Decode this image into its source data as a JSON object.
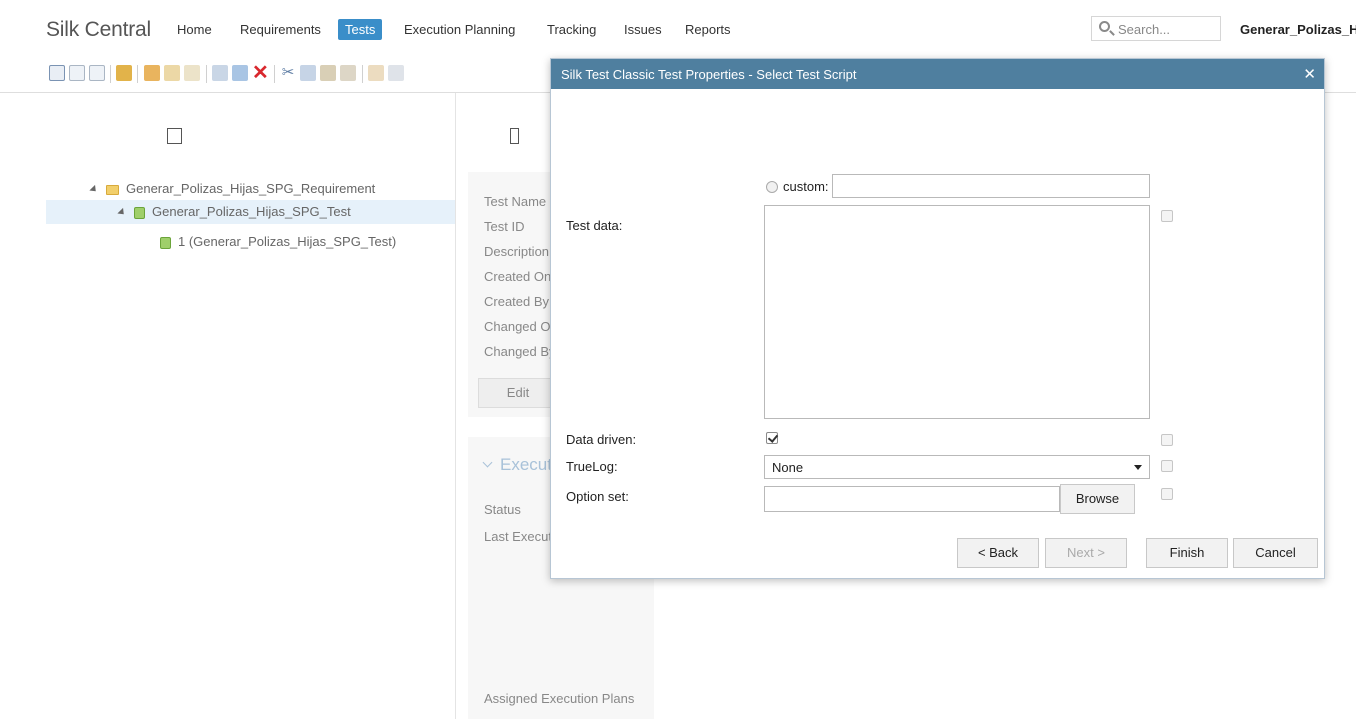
{
  "app": {
    "title": "Silk Central"
  },
  "nav": {
    "items": [
      "Home",
      "Requirements",
      "Tests",
      "Execution Planning",
      "Tracking",
      "Issues",
      "Reports"
    ],
    "active": "Tests",
    "search_placeholder": "Search...",
    "user": "Generar_Polizas_Hijas_SPG"
  },
  "toolbar": {
    "icons": [
      "view-tree-icon",
      "view-details-icon",
      "view-grid-icon",
      "upload-icon",
      "new-folder-icon",
      "folder-icon",
      "copy-doc-icon",
      "edit-icon",
      "new-test-icon",
      "delete-icon",
      "cut-icon",
      "copy-icon",
      "paste-icon",
      "paste-as-child-icon",
      "move-up-icon",
      "move-down-icon"
    ],
    "delete_color": "#d9282e"
  },
  "tree": {
    "items": [
      {
        "label": "Generar_Polizas_Hijas_SPG_Requirement",
        "icon": "folder-icon"
      },
      {
        "label": "Generar_Polizas_Hijas_SPG_Test",
        "icon": "test-icon",
        "selected": true
      },
      {
        "label": "1 (Generar_Polizas_Hijas_SPG_Test)",
        "icon": "test-icon"
      }
    ]
  },
  "properties": {
    "labels": [
      "Test Name",
      "Test ID",
      "Description",
      "Created On",
      "Created By",
      "Changed On",
      "Changed By"
    ],
    "edit_label": "Edit",
    "execution_section": "Execution",
    "status_label": "Status",
    "last_execution_label": "Last Execution",
    "assigned_plans_label": "Assigned Execution Plans"
  },
  "dialog": {
    "title": "Silk Test Classic Test Properties - Select Test Script",
    "custom_label": "custom:",
    "test_data_label": "Test data:",
    "data_driven_label": "Data driven:",
    "data_driven_checked": true,
    "truelog_label": "TrueLog:",
    "truelog_value": "None",
    "option_set_label": "Option set:",
    "browse_label": "Browse",
    "back_label": "< Back",
    "next_label": "Next >",
    "finish_label": "Finish",
    "cancel_label": "Cancel"
  },
  "colors": {
    "accent": "#3a8ec9",
    "dialog_title_bar": "#4f7f9f",
    "selected_row": "#e6f1fa"
  }
}
